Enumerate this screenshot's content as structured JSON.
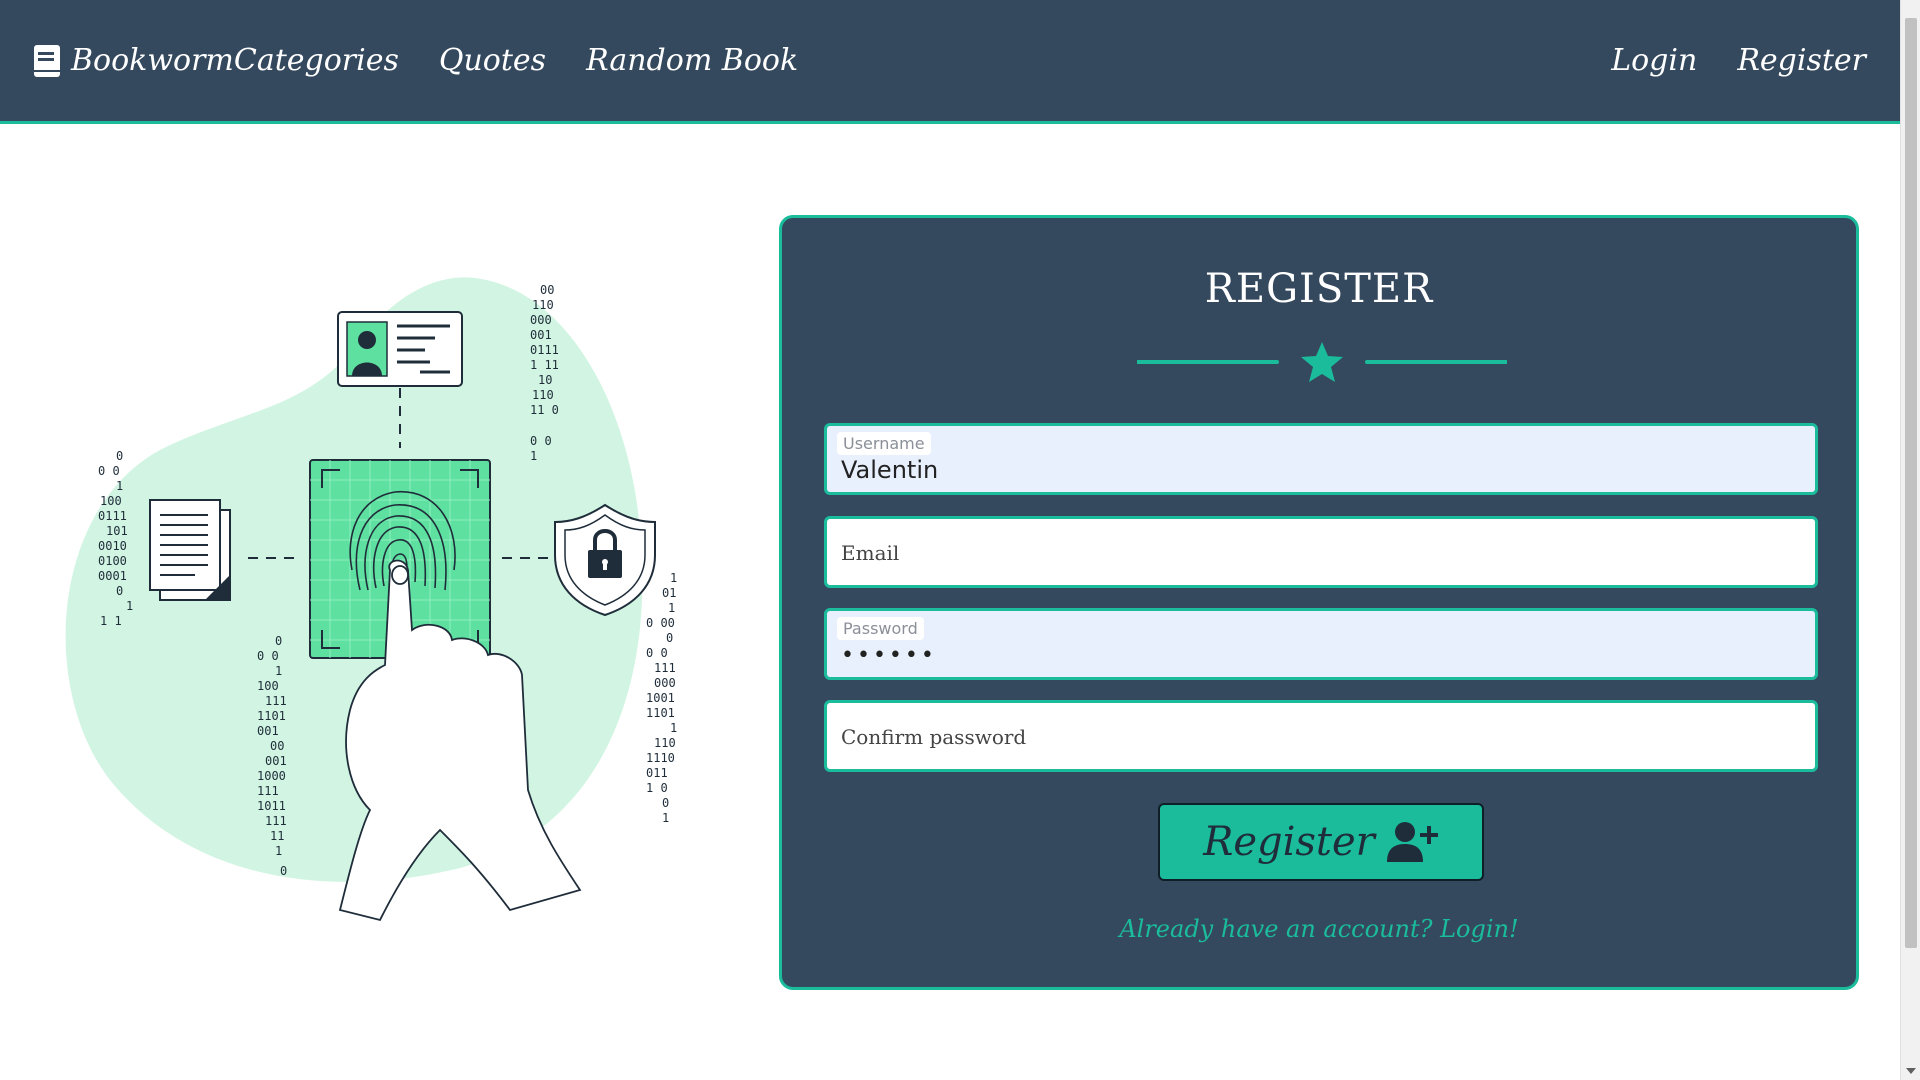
{
  "nav": {
    "brand": "Bookworm",
    "links": [
      "Categories",
      "Quotes",
      "Random Book"
    ],
    "login": "Login",
    "register": "Register"
  },
  "card": {
    "title": "REGISTER",
    "username_label": "Username",
    "username_value": "Valentin",
    "email_placeholder": "Email",
    "password_label": "Password",
    "password_dots": "••••••",
    "confirm_placeholder": "Confirm password",
    "submit_label": "Register",
    "login_link": "Already have an account? Login!"
  },
  "illustration": {
    "binary_columns": [
      [
        "00",
        "110",
        "000",
        "001",
        "0111",
        "1 11",
        "10",
        "110",
        "11 0",
        "0  0",
        "1"
      ],
      [
        "0",
        "0 0",
        "1",
        "100",
        "0111",
        "101",
        "0010",
        "0100",
        "0001",
        "0",
        "1",
        "1 1"
      ],
      [
        "0",
        "0 0",
        "1",
        "100",
        "111",
        "1101",
        "001",
        "00",
        "001",
        "1000",
        "111",
        "1011",
        "111",
        "11",
        "1",
        "0"
      ],
      [
        "1",
        "01",
        "1",
        "0 00",
        "0",
        "0 0",
        "111",
        "000",
        "1001",
        "1101",
        "1",
        "110",
        "1110",
        "011",
        "1 0",
        "0",
        "1"
      ]
    ]
  },
  "colors": {
    "nav_bg": "#34495e",
    "accent": "#1abc9c",
    "card_bg": "#34495e",
    "blob": "#d2f5e3",
    "scanner": "#5ee0a0"
  },
  "icons": [
    "book-icon",
    "star-icon",
    "user-plus-icon",
    "fingerprint-icon",
    "shield-lock-icon",
    "id-card-icon",
    "document-icon"
  ]
}
